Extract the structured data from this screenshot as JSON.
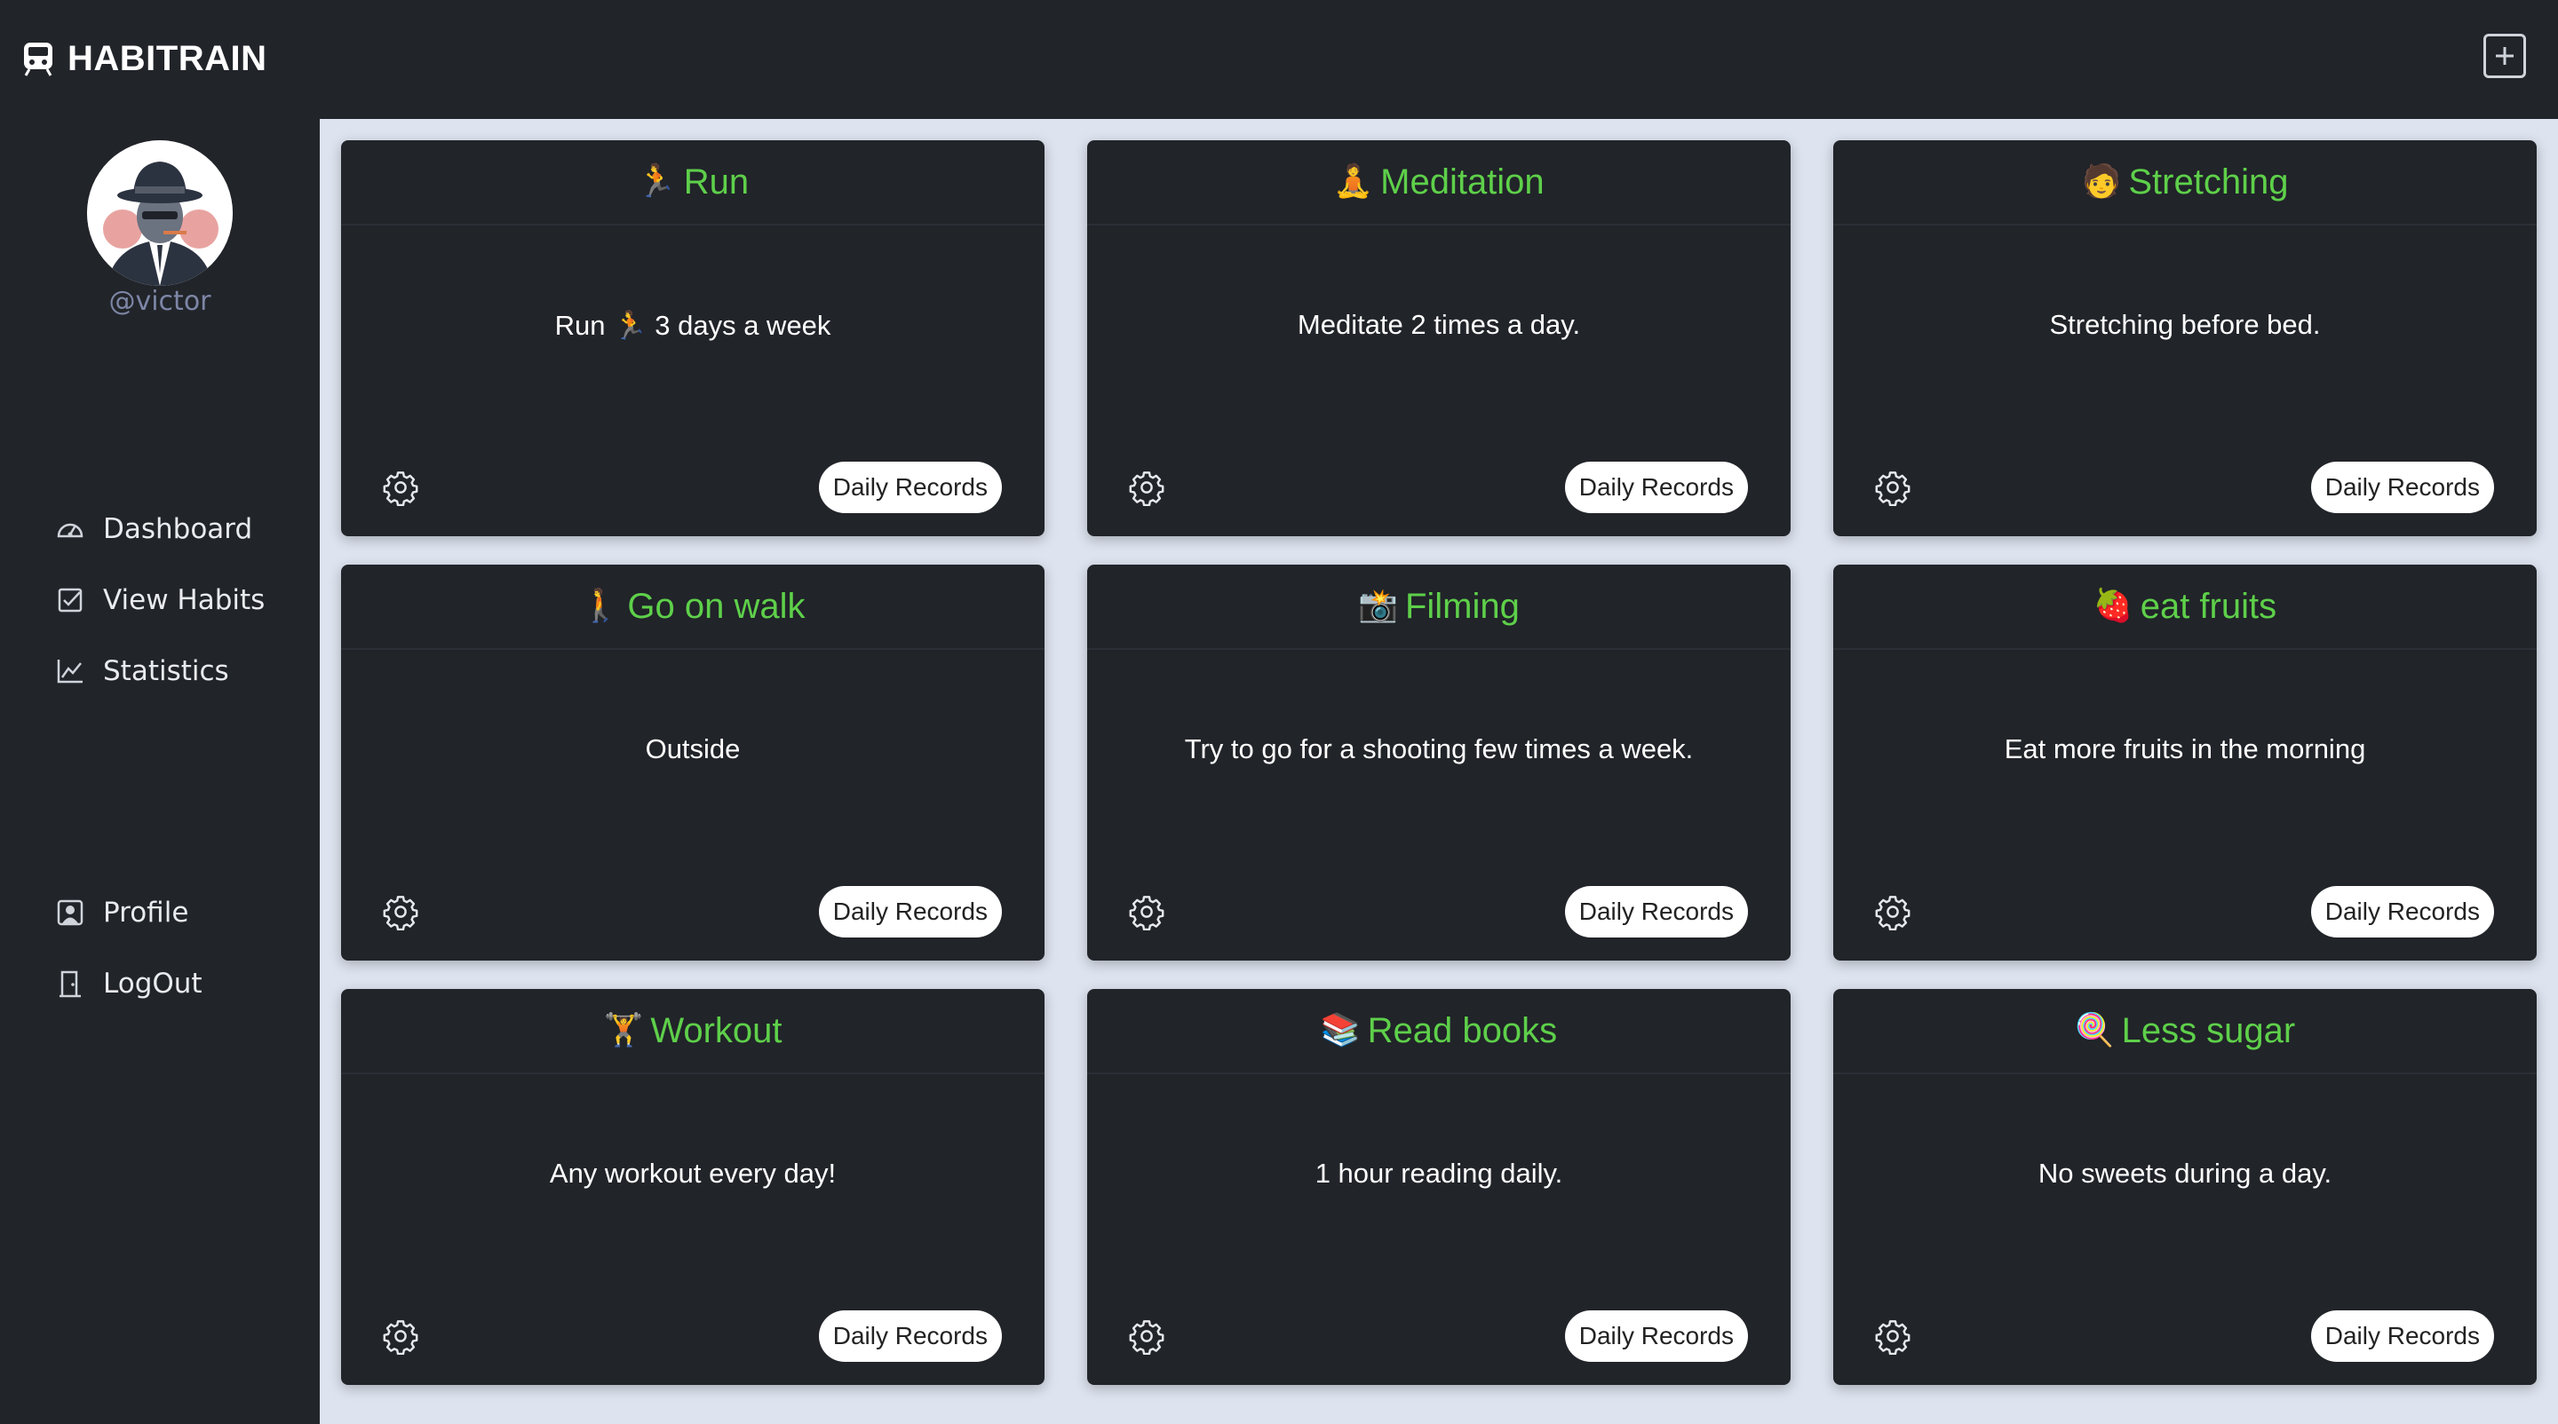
{
  "app": {
    "name": "HABITRAIN",
    "logo_icon": "train-icon",
    "add_icon": "plus-square-icon"
  },
  "user": {
    "handle": "@victor",
    "avatar": "detective-avatar"
  },
  "nav": {
    "main": [
      {
        "label": "Dashboard",
        "icon": "speedometer-icon"
      },
      {
        "label": "View Habits",
        "icon": "check-square-icon"
      },
      {
        "label": "Statistics",
        "icon": "line-chart-icon"
      }
    ],
    "bottom": [
      {
        "label": "Profile",
        "icon": "person-square-icon"
      },
      {
        "label": "LogOut",
        "icon": "door-icon"
      }
    ]
  },
  "colors": {
    "bg": "#212429",
    "content": "#dde3ef",
    "title": "#5ed04a",
    "handle": "#7d86a6"
  },
  "records_label": "Daily Records",
  "habits": [
    {
      "emoji": "🏃",
      "title": "Run",
      "description": "Run 🏃 3 days a week"
    },
    {
      "emoji": "🧘",
      "title": "Meditation",
      "description": "Meditate 2 times a day."
    },
    {
      "emoji": "🧑",
      "title": "Stretching",
      "description": "Stretching before bed."
    },
    {
      "emoji": "🚶",
      "title": "Go on walk",
      "description": "Outside"
    },
    {
      "emoji": "📸",
      "title": "Filming",
      "description": "Try to go for a shooting few times a week."
    },
    {
      "emoji": "🍓",
      "title": "eat fruits",
      "description": "Eat more fruits in the morning"
    },
    {
      "emoji": "🏋",
      "title": "Workout",
      "description": "Any workout every day!"
    },
    {
      "emoji": "📚",
      "title": "Read books",
      "description": "1 hour reading daily."
    },
    {
      "emoji": "🍭",
      "title": "Less sugar",
      "description": "No sweets during a day."
    }
  ]
}
